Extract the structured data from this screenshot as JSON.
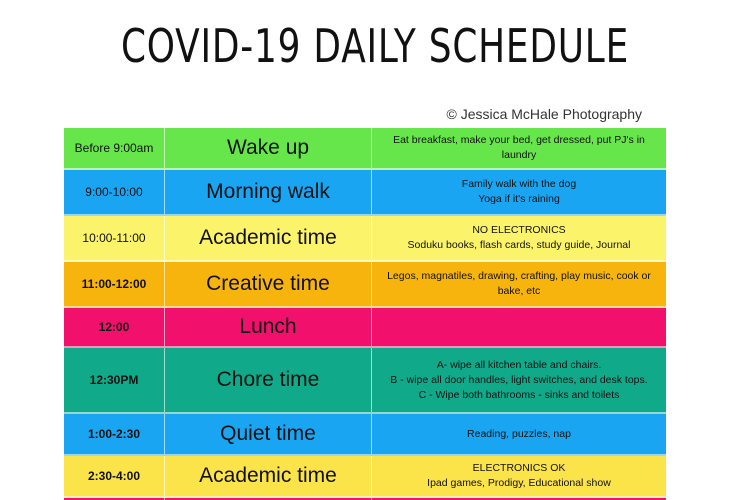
{
  "title": "COVID-19 DAILY SCHEDULE",
  "credit": "© Jessica McHale Photography",
  "rows": [
    {
      "time": "Before 9:00am",
      "activity": "Wake up",
      "details": [
        "Eat breakfast, make your bed, get dressed, put PJ's in",
        "laundry"
      ],
      "color": "#66e64a",
      "bold_time": false
    },
    {
      "time": "9:00-10:00",
      "activity": "Morning walk",
      "details": [
        "Family walk with the dog",
        "Yoga if it's raining"
      ],
      "color": "#1aa5f2",
      "bold_time": false
    },
    {
      "time": "10:00-11:00",
      "activity": "Academic time",
      "details": [
        "NO ELECTRONICS",
        "Soduku books, flash cards, study guide, Journal"
      ],
      "color": "#fbf46a",
      "bold_time": false
    },
    {
      "time": "11:00-12:00",
      "activity": "Creative time",
      "details": [
        "Legos, magnatiles, drawing, crafting, play music, cook or",
        "bake, etc"
      ],
      "color": "#f7b40c",
      "bold_time": true
    },
    {
      "time": "12:00",
      "activity": "Lunch",
      "details": [],
      "color": "#f1106c",
      "bold_time": true
    },
    {
      "time": "12:30PM",
      "activity": "Chore time",
      "details": [
        "A- wipe all kitchen table and chairs.",
        "B - wipe all door handles, light switches, and desk tops.",
        "C - Wipe both bathrooms - sinks and toilets"
      ],
      "color": "#10a98a",
      "bold_time": true
    },
    {
      "time": "1:00-2:30",
      "activity": "Quiet time",
      "details": [
        "Reading, puzzles, nap"
      ],
      "color": "#1aa5f2",
      "bold_time": true
    },
    {
      "time": "2:30-4:00",
      "activity": "Academic time",
      "details": [
        "ELECTRONICS OK",
        "Ipad games, Prodigy, Educational show"
      ],
      "color": "#fbe34a",
      "bold_time": true
    },
    {
      "time": "",
      "activity": "",
      "details": [],
      "color": "#f1106c",
      "bold_time": false
    }
  ]
}
